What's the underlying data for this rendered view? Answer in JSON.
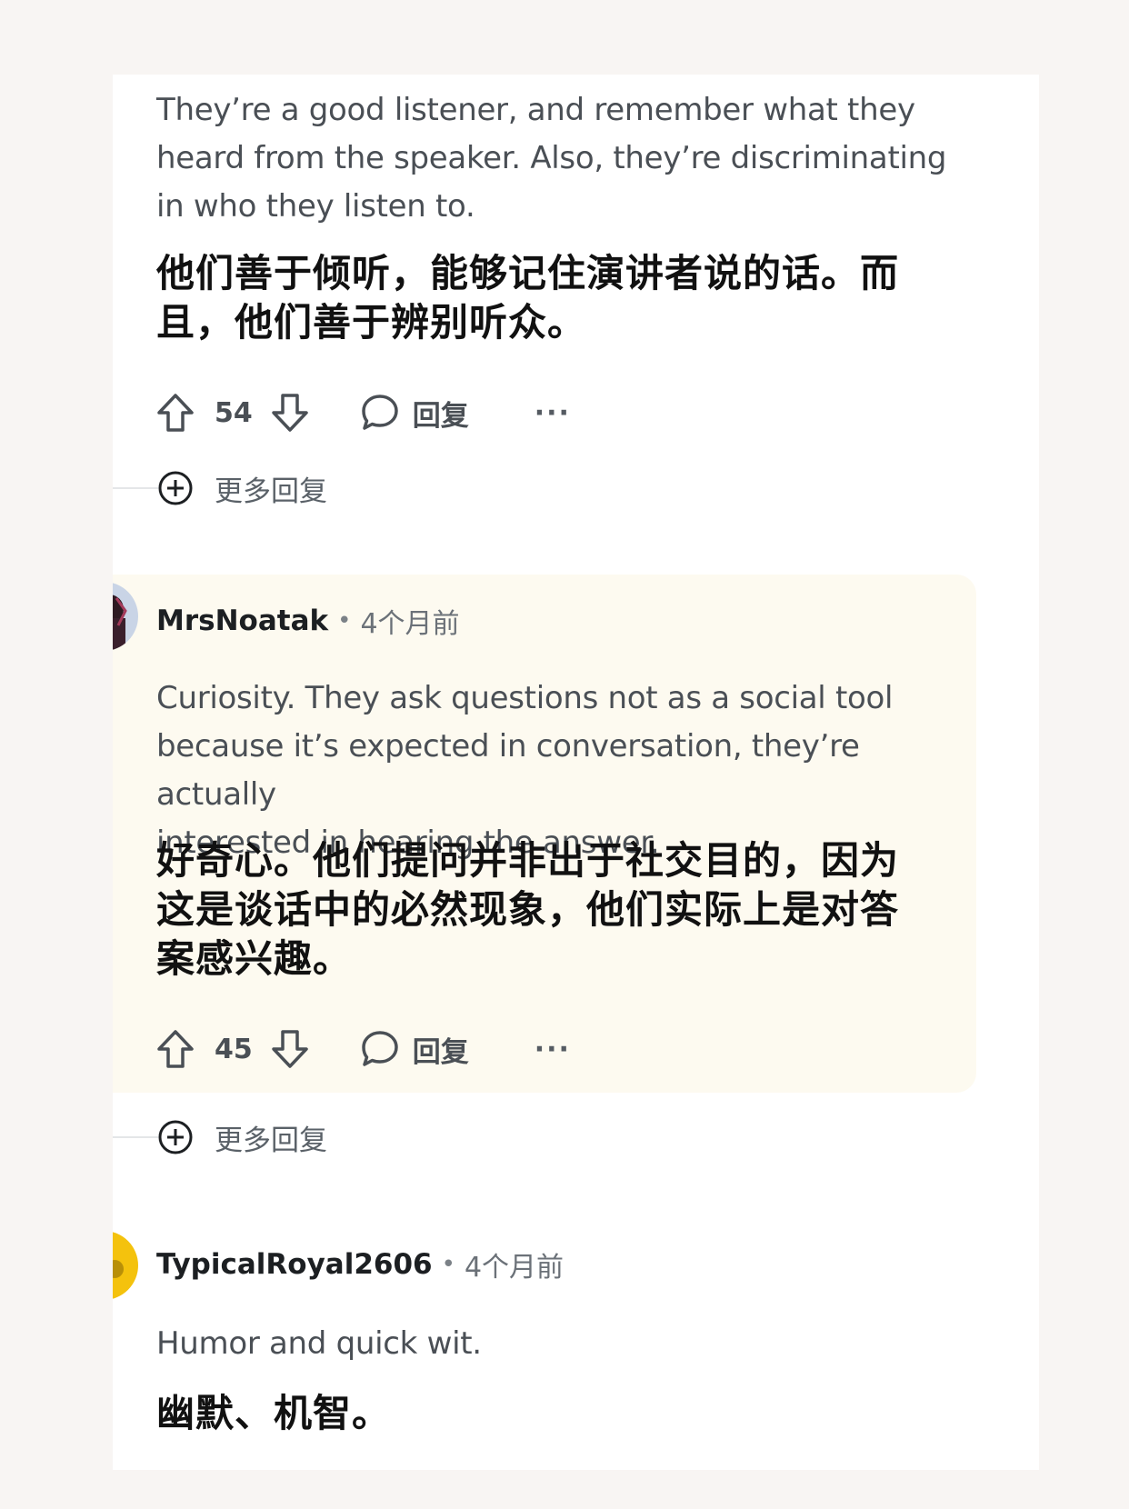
{
  "comments": [
    {
      "body_en": [
        "They’re a good listener, and remember what they",
        "heard from the speaker. Also, they’re discriminating",
        "in who they listen to."
      ],
      "body_zh": [
        "他们善于倾听，能够记住演讲者说的话。而",
        "且，他们善于辨别听众。"
      ],
      "score": "54",
      "reply_label": "回复",
      "more_label": "···",
      "more_replies_label": "更多回复"
    },
    {
      "username": "MrsNoatak",
      "separator": "•",
      "timestamp": "4个月前",
      "body_en": [
        "Curiosity. They ask questions not as a social tool",
        "because it’s expected in conversation, they’re actually",
        "interested in hearing the answer."
      ],
      "body_zh": [
        "好奇心。他们提问并非出于社交目的，因为",
        "这是谈话中的必然现象，他们实际上是对答",
        "案感兴趣。"
      ],
      "score": "45",
      "reply_label": "回复",
      "more_label": "···",
      "more_replies_label": "更多回复"
    },
    {
      "username": "TypicalRoyal2606",
      "separator": "•",
      "timestamp": "4个月前",
      "body_en": [
        "Humor and quick wit."
      ],
      "body_zh": [
        "幽默、机智。"
      ]
    }
  ],
  "colors": {
    "page_background": "#f8f5f3",
    "card_background": "#ffffff",
    "highlight_background": "#fdfaf0",
    "text_secondary": "#4a4f55"
  }
}
